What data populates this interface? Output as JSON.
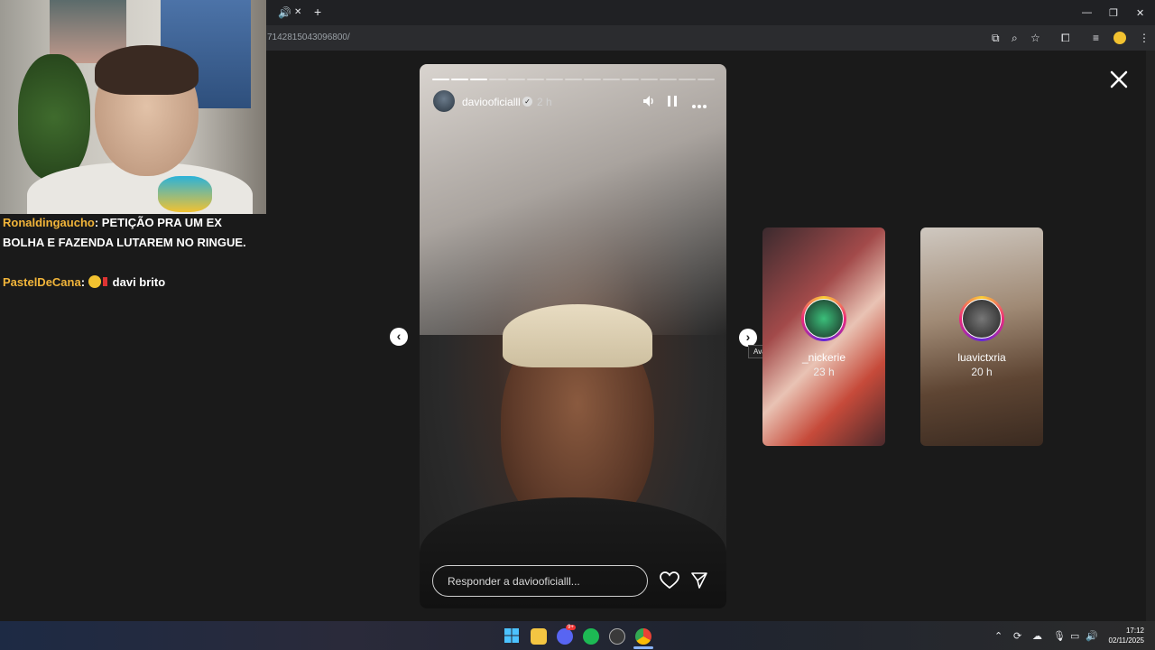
{
  "browser": {
    "url": "7142815043096800/",
    "tab_close": "✕",
    "new_tab": "+"
  },
  "stream_chat": [
    {
      "user": "Ronaldingaucho",
      "message": "PETIÇÃO PRA UM EX BOLHA E FAZENDA LUTAREM NO RINGUE."
    },
    {
      "user": "PastelDeCana",
      "message": "davi brito"
    }
  ],
  "story": {
    "username": "daviooficialll",
    "time": "2 h",
    "verified": true,
    "progress_segments": 15,
    "progress_done": 3,
    "reply_placeholder": "Responder a daviooficialll...",
    "next_tooltip": "Avançar"
  },
  "previews": [
    {
      "username": "_nickerie",
      "time": "23 h"
    },
    {
      "username": "luavictxria",
      "time": "20 h"
    }
  ],
  "taskbar": {
    "time": "17:12",
    "date": "02/11/2025",
    "discord_badge": "9+"
  },
  "icons": [
    "volume-icon",
    "pause-icon",
    "more-icon",
    "close-icon",
    "heart-icon",
    "send-icon",
    "chevron-left-icon",
    "chevron-right-icon",
    "verified-icon"
  ]
}
